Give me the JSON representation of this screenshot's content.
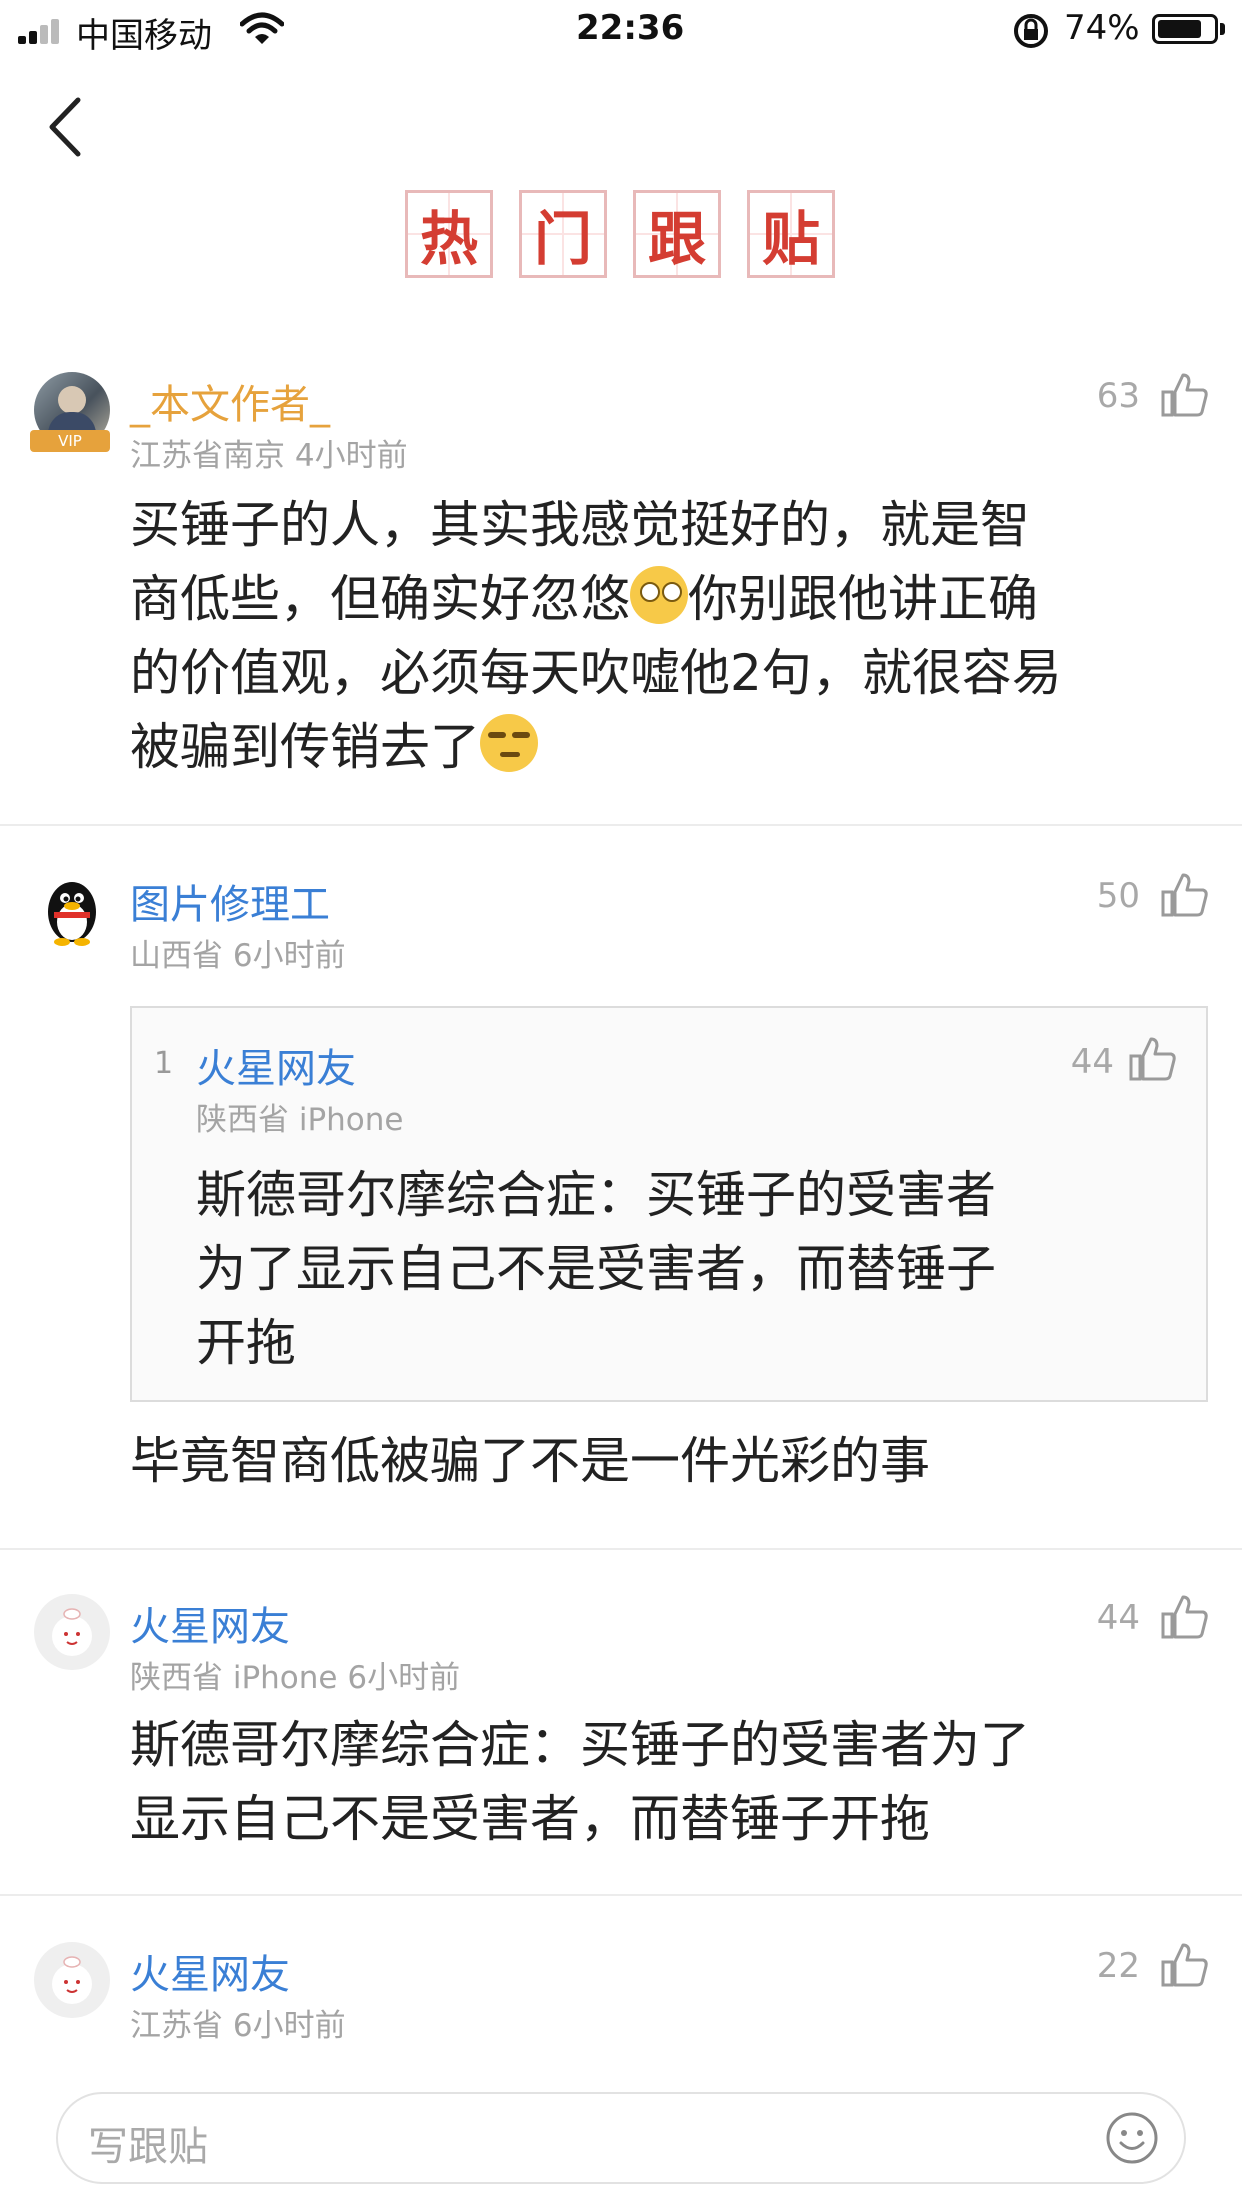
{
  "status_bar": {
    "carrier": "中国移动",
    "time": "22:36",
    "battery": "74%",
    "battery_level": 0.74
  },
  "header": {
    "title_chars": [
      "热",
      "门",
      "跟",
      "贴"
    ]
  },
  "comments": [
    {
      "username": "_本文作者_",
      "vip_badge": "VIP",
      "meta": "江苏省南京  4小时前",
      "likes": "63",
      "body_lines": [
        "买锤子的人，其实我感觉挺好的，就是智",
        "商低些，但确实好忽悠",
        "你别跟他讲正确",
        "的价值观，必须每天吹嘘他2句，就很容易",
        "被骗到传销去了"
      ]
    },
    {
      "username": "图片修理工",
      "meta": "山西省  6小时前",
      "likes": "50",
      "quote": {
        "index": "1",
        "username": "火星网友",
        "meta": "陕西省  iPhone",
        "likes": "44",
        "body_lines": [
          "斯德哥尔摩综合症：买锤子的受害者",
          "为了显示自己不是受害者，而替锤子",
          "开拖"
        ]
      },
      "body": "毕竟智商低被骗了不是一件光彩的事"
    },
    {
      "username": "火星网友",
      "meta": "陕西省  iPhone  6小时前",
      "likes": "44",
      "body_lines": [
        "斯德哥尔摩综合症：买锤子的受害者为了",
        "显示自己不是受害者，而替锤子开拖"
      ]
    },
    {
      "username": "火星网友",
      "meta": "江苏省  6小时前",
      "likes": "22"
    }
  ],
  "input": {
    "placeholder": "写跟贴"
  }
}
